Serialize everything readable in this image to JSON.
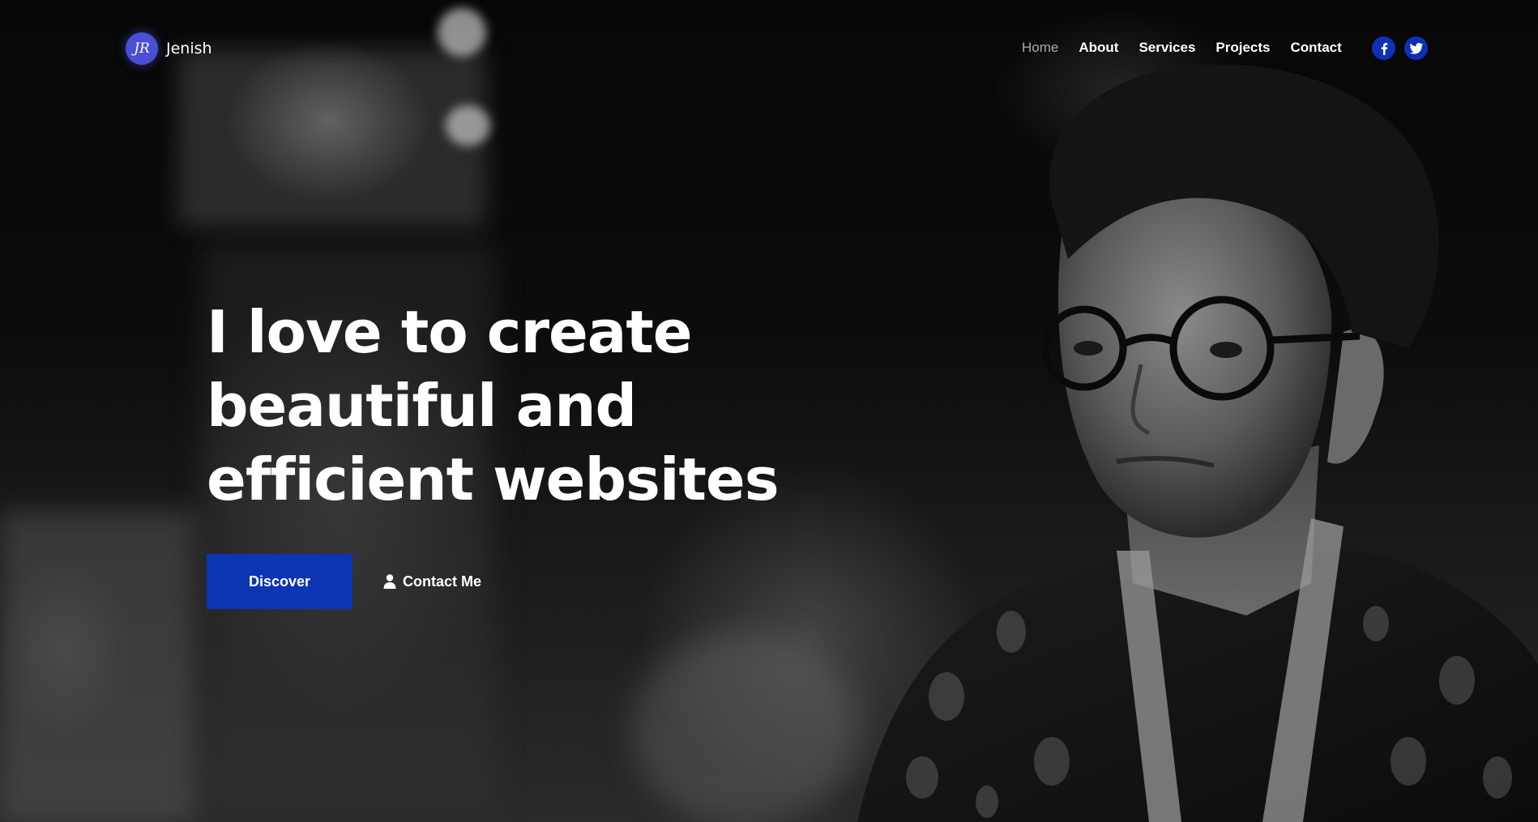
{
  "brand": {
    "logo_text": "JR",
    "name": "Jenish"
  },
  "nav": {
    "items": [
      {
        "label": "Home",
        "active": true
      },
      {
        "label": "About",
        "active": false
      },
      {
        "label": "Services",
        "active": false
      },
      {
        "label": "Projects",
        "active": false
      },
      {
        "label": "Contact",
        "active": false
      }
    ],
    "socials": [
      {
        "icon": "facebook-icon"
      },
      {
        "icon": "twitter-icon"
      }
    ]
  },
  "hero": {
    "headline_line1": "I love to create",
    "headline_line2": "beautiful and",
    "headline_line3": "efficient websites",
    "primary_button": "Discover",
    "secondary_button": "Contact Me",
    "secondary_icon": "user-icon"
  },
  "colors": {
    "accent": "#0c35b4",
    "logo": "#4a4fd4",
    "social_bg": "#0f2fb5",
    "nav_active": "#a9a9b4"
  }
}
